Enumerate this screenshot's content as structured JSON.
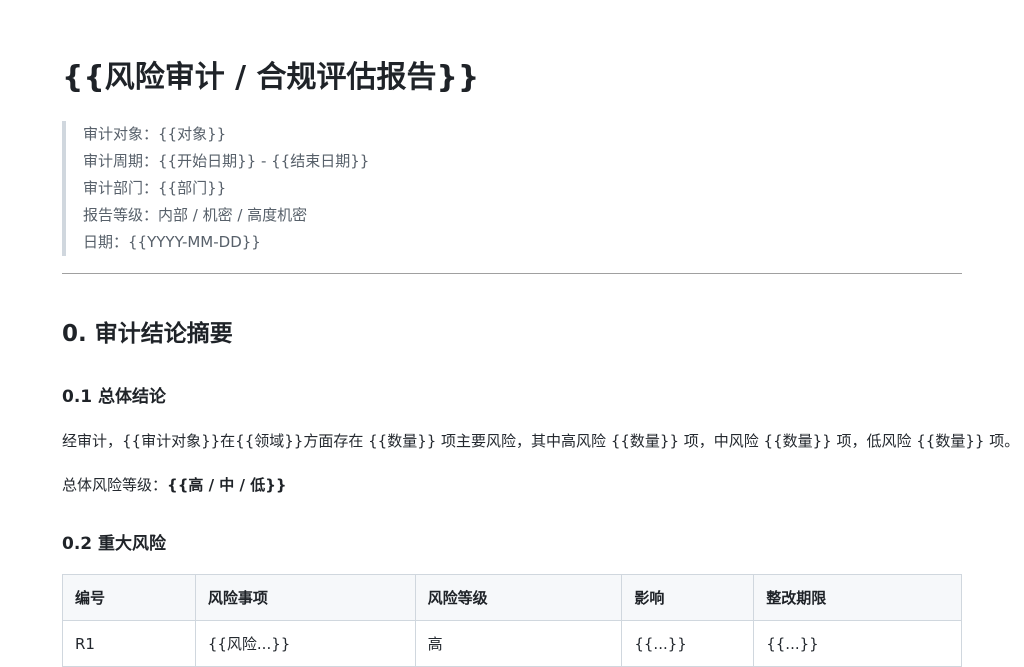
{
  "title": "{{风险审计 / 合规评估报告}}",
  "meta": [
    "审计对象：{{对象}}",
    "审计周期：{{开始日期}} - {{结束日期}}",
    "审计部门：{{部门}}",
    "报告等级：内部 / 机密 / 高度机密",
    "日期：{{YYYY-MM-DD}}"
  ],
  "section0": {
    "heading": "0. 审计结论摘要",
    "sub1": {
      "heading": "0.1 总体结论",
      "paragraph": "经审计，{{审计对象}}在{{领域}}方面存在 {{数量}} 项主要风险，其中高风险 {{数量}} 项，中风险 {{数量}} 项，低风险 {{数量}} 项。",
      "level_label": "总体风险等级：",
      "level_value": "{{高 / 中 / 低}}"
    },
    "sub2": {
      "heading": "0.2 重大风险",
      "table": {
        "headers": [
          "编号",
          "风险事项",
          "风险等级",
          "影响",
          "整改期限"
        ],
        "rows": [
          [
            "R1",
            "{{风险...}}",
            "高",
            "{{...}}",
            "{{...}}"
          ]
        ]
      }
    }
  }
}
